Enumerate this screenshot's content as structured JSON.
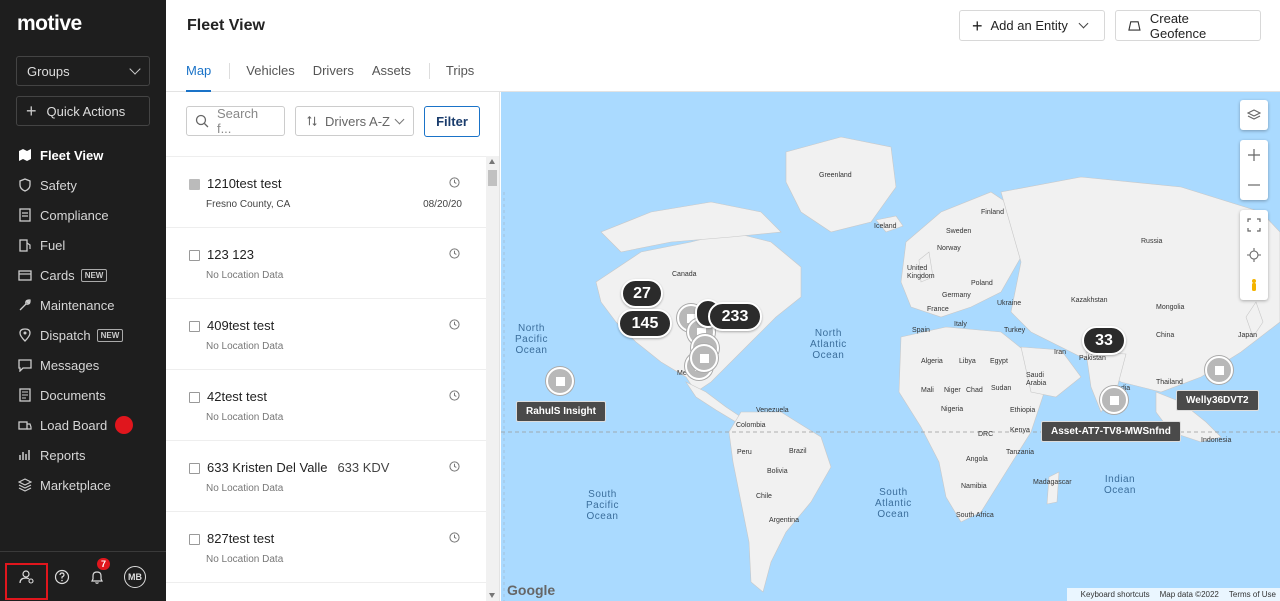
{
  "app": {
    "logo": "motive"
  },
  "sidebar": {
    "groups_label": "Groups",
    "quick_actions_label": "Quick Actions",
    "items": [
      {
        "label": "Fleet View",
        "icon": "map-icon",
        "active": true
      },
      {
        "label": "Safety",
        "icon": "shield-icon"
      },
      {
        "label": "Compliance",
        "icon": "document-icon"
      },
      {
        "label": "Fuel",
        "icon": "fuel-icon"
      },
      {
        "label": "Cards",
        "icon": "card-icon",
        "badge": "NEW"
      },
      {
        "label": "Maintenance",
        "icon": "wrench-icon"
      },
      {
        "label": "Dispatch",
        "icon": "pin-icon",
        "badge": "NEW"
      },
      {
        "label": "Messages",
        "icon": "message-icon"
      },
      {
        "label": "Documents",
        "icon": "file-icon"
      },
      {
        "label": "Load Board",
        "icon": "truck-icon"
      },
      {
        "label": "Reports",
        "icon": "chart-icon"
      },
      {
        "label": "Marketplace",
        "icon": "layers-icon"
      }
    ],
    "notification_count": "7",
    "avatar_initials": "MB"
  },
  "header": {
    "title": "Fleet View",
    "add_entity_label": "Add an Entity",
    "create_geofence_label": "Create Geofence",
    "tabs": [
      "Map",
      "Vehicles",
      "Drivers",
      "Assets",
      "Trips"
    ]
  },
  "list": {
    "search_placeholder": "Search f...",
    "sort_label": "Drivers A-Z",
    "filter_label": "Filter",
    "rows": [
      {
        "name": "1210test test",
        "sub": "Fresno County, CA",
        "date": "08/20/20"
      },
      {
        "name": "123 123",
        "sub": "No Location Data",
        "date": ""
      },
      {
        "name": "409test test",
        "sub": "No Location Data",
        "date": ""
      },
      {
        "name": "42test test",
        "sub": "No Location Data",
        "date": ""
      },
      {
        "name": "633 Kristen Del Valle",
        "tag": "633 KDV",
        "sub": "No Location Data",
        "date": ""
      },
      {
        "name": "827test test",
        "sub": "No Location Data",
        "date": ""
      }
    ]
  },
  "map": {
    "countries": [
      "Greenland",
      "Iceland",
      "Finland",
      "Sweden",
      "Norway",
      "Russia",
      "United Kingdom",
      "Poland",
      "Germany",
      "Ukraine",
      "France",
      "Kazakhstan",
      "Spain",
      "Italy",
      "Turkey",
      "China",
      "Iran",
      "Pakistan",
      "Algeria",
      "Libya",
      "Egypt",
      "Saudi Arabia",
      "Mali",
      "Niger",
      "Chad",
      "Sudan",
      "Nigeria",
      "Ethiopia",
      "Kenya",
      "DRC",
      "Tanzania",
      "Angola",
      "Namibia",
      "South Africa",
      "Madagascar",
      "Thailand",
      "Indonesia",
      "Canada",
      "Mexico",
      "Venezuela",
      "Colombia",
      "Peru",
      "Brazil",
      "Bolivia",
      "Chile",
      "Argentina",
      "India",
      "Mongolia",
      "Japan"
    ],
    "oceans": {
      "north_pacific": "North\nPacific\nOcean",
      "north_atlantic": "North\nAtlantic\nOcean",
      "south_pacific": "South\nPacific\nOcean",
      "south_atlantic": "South\nAtlantic\nOcean",
      "indian": "Indian\nOcean"
    },
    "clusters": [
      "27",
      "145",
      "233",
      "33"
    ],
    "asset_labels": [
      "RahulS Insight",
      "Asset-AT7-TV8-MWSnfnd",
      "Welly36DVT2"
    ],
    "footer": {
      "shortcuts": "Keyboard shortcuts",
      "mapdata": "Map data ©2022",
      "terms": "Terms of Use"
    },
    "google": "Google",
    "land_color": "#f1f1f1",
    "water_color": "#aadaff"
  }
}
